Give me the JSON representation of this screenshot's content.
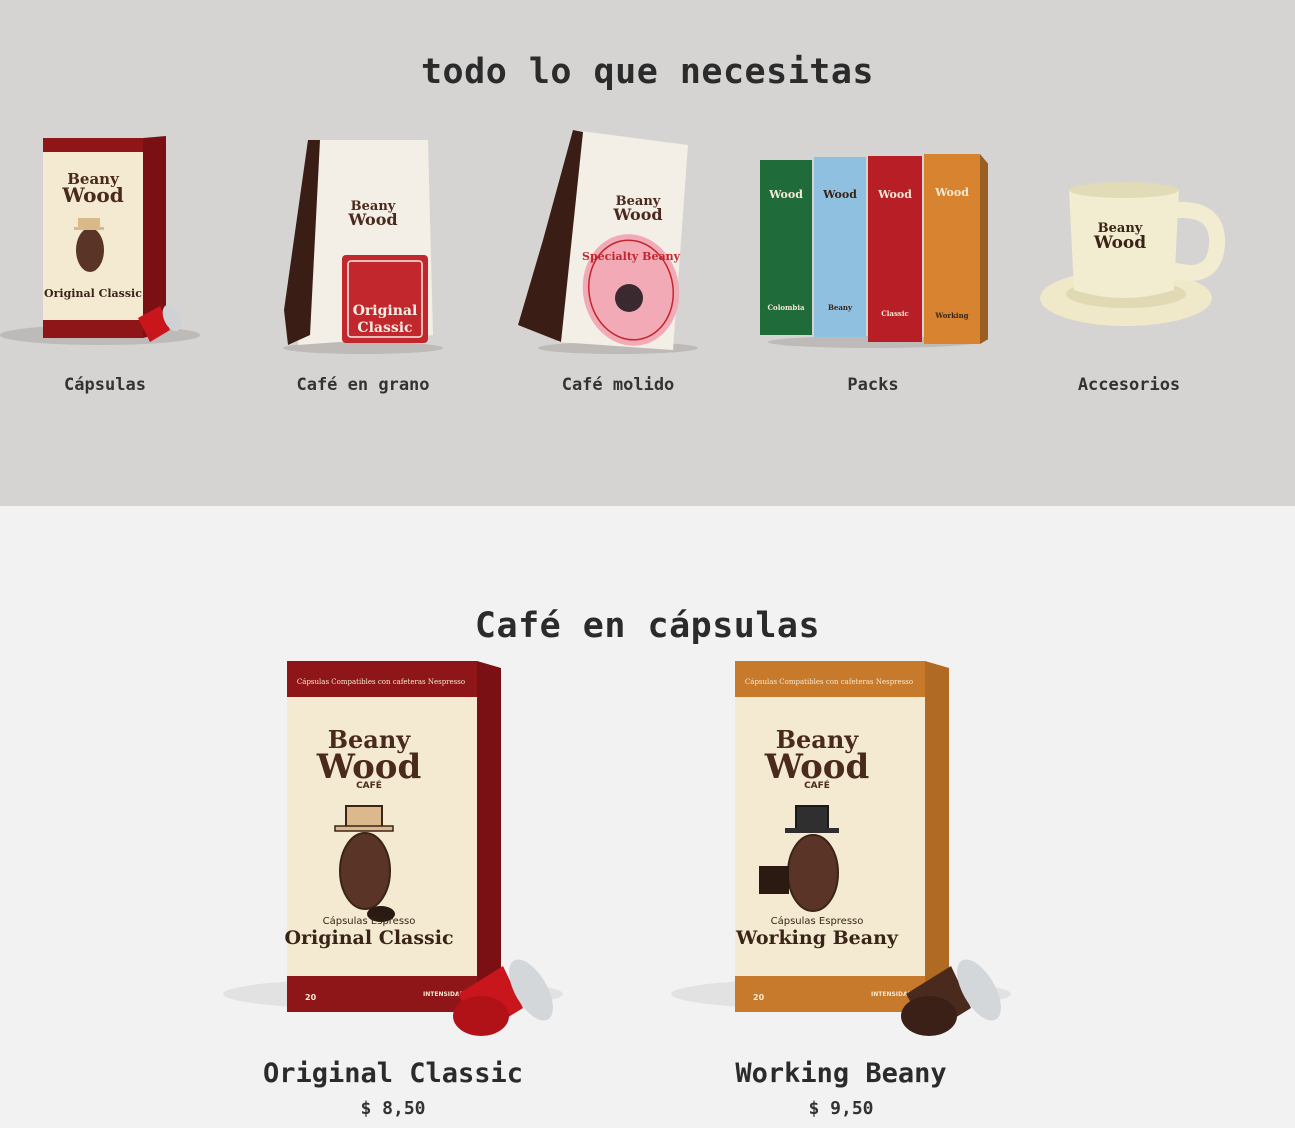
{
  "categories_section": {
    "title": "todo lo que necesitas",
    "items": [
      {
        "label": "Cápsulas"
      },
      {
        "label": "Café en grano"
      },
      {
        "label": "Café molido"
      },
      {
        "label": "Packs"
      },
      {
        "label": "Accesorios"
      }
    ]
  },
  "products_section": {
    "title": "Café en cápsulas",
    "products": [
      {
        "name": "Original Classic",
        "price": "$ 8,50",
        "box_color": "#8e1518",
        "box_text": "Original Classic"
      },
      {
        "name": "Working Beany",
        "price": "$ 9,50",
        "box_color": "#c7792c",
        "box_text": "Working Beany"
      }
    ]
  },
  "packaging": {
    "brand_line1": "Beany",
    "brand_line2": "Wood",
    "brand_line3": "CAFÉ",
    "capsule_subtitle": "Cápsulas Espresso",
    "capsule_header": "Cápsulas Compatibles con cafeteras Nespresso",
    "intensity_label": "INTENSIDAD",
    "count": "20",
    "ground_label": "Specialty Beany",
    "grain_label_1": "Original",
    "grain_label_2": "Classic",
    "pack_colombia": "Colombia",
    "pack_beany": "Beany",
    "pack_classic": "Classic",
    "pack_working": "Working"
  }
}
